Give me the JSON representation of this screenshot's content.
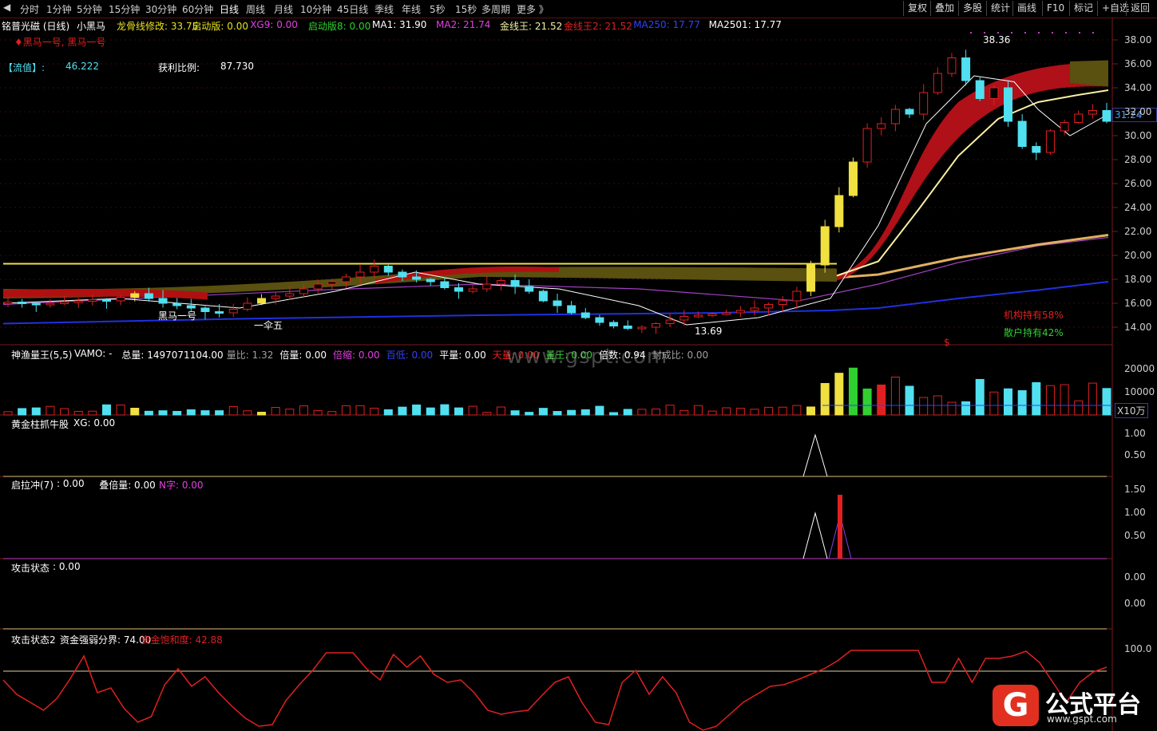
{
  "toolbar": {
    "periods": [
      "分时",
      "1分钟",
      "5分钟",
      "15分钟",
      "30分钟",
      "60分钟",
      "日线",
      "周线",
      "月线",
      "10分钟",
      "45日线",
      "季线",
      "年线",
      "5秒",
      "15秒",
      "多周期",
      "更多 》"
    ],
    "active_period": "日线",
    "right_buttons": [
      "复权",
      "叠加",
      "多股",
      "统计",
      "画线",
      "F10",
      "标记",
      "+自选",
      "返回"
    ]
  },
  "main_panel": {
    "stock_title": "铭普光磁 (日线)",
    "indicator_name": "小黑马",
    "params": [
      {
        "label": "龙骨线修改: 33.75",
        "color": "#e8e020"
      },
      {
        "label": "启动版: 0.00",
        "color": "#e8e020"
      },
      {
        "label": "XG9: 0.00",
        "color": "#e040e0"
      },
      {
        "label": "启动版8: 0.00",
        "color": "#30d030"
      },
      {
        "label": "MA1: 31.90",
        "color": "#ffffff"
      },
      {
        "label": "MA2: 21.74",
        "color": "#e040e0"
      },
      {
        "label": "金线王: 21.52",
        "color": "#f0f0a0"
      },
      {
        "label": "金线王2: 21.52",
        "color": "#e02020"
      },
      {
        "label": "MA250: 17.77",
        "color": "#3040ff"
      },
      {
        "label": "MA2501: 17.77",
        "color": "#ffffff"
      }
    ],
    "signal_text": "♦黑马一号, 黑马一号",
    "float_label": "【流值】:",
    "float_value": "46.222",
    "profit_label": "获利比例:",
    "profit_value": "87.730",
    "price_ticks": [
      "38.00",
      "36.00",
      "34.00",
      "32.00",
      "30.00",
      "28.00",
      "26.00",
      "24.00",
      "22.00",
      "20.00",
      "18.00",
      "16.00",
      "14.00"
    ],
    "current_price": "31.24",
    "high_marker": "38.36",
    "low_marker": "13.69",
    "annotation_heima": "黑马一号",
    "annotation_yisan": "一伞五",
    "inst_hold": "机构持有58%",
    "retail_hold": "散户持有42%",
    "dollar_mark": "$"
  },
  "volume_panel": {
    "title": "神渔量王(5,5)",
    "fields": [
      {
        "label": "VAMO: -",
        "color": "#ffffff"
      },
      {
        "label": "总量: 1497071104.00",
        "color": "#ffffff"
      },
      {
        "label": "量比: 1.32",
        "color": "#a0a0a0"
      },
      {
        "label": "倍量: 0.00",
        "color": "#ffffff"
      },
      {
        "label": "倍缩: 0.00",
        "color": "#e040e0"
      },
      {
        "label": "百低: 0.00",
        "color": "#3040ff"
      },
      {
        "label": "平量: 0.00",
        "color": "#ffffff"
      },
      {
        "label": "天量: 0.00",
        "color": "#e02020"
      },
      {
        "label": "量王: 0.00",
        "color": "#30d030"
      },
      {
        "label": "倍数: 0.94",
        "color": "#ffffff"
      },
      {
        "label": "封成比: 0.00",
        "color": "#a0a0a0"
      }
    ],
    "ticks": [
      "20000",
      "10000"
    ],
    "unit": "X10万"
  },
  "panel_xg": {
    "title": "黄金柱抓牛股",
    "field": "XG: 0.00",
    "ticks": [
      "1.00",
      "0.50"
    ]
  },
  "panel_qlc": {
    "title": "启拉冲(7)",
    "fields": [
      {
        "label": ": 0.00",
        "color": "#ffffff"
      },
      {
        "label": "叠倍量: 0.00",
        "color": "#ffffff"
      },
      {
        "label": "N字: 0.00",
        "color": "#e040e0"
      }
    ],
    "ticks": [
      "1.50",
      "1.00",
      "0.50"
    ]
  },
  "panel_attack": {
    "title": "攻击状态",
    "field": ": 0.00",
    "ticks": [
      "0.00",
      "0.00"
    ]
  },
  "panel_attack2": {
    "title": "攻击状态2",
    "fields": [
      {
        "label": "资金强弱分界: 74.00",
        "color": "#ffffff"
      },
      {
        "label": "资金饱和度: 42.88",
        "color": "#e02020"
      }
    ],
    "ticks": [
      "100.0"
    ]
  },
  "watermark": "www.gspt.com",
  "logo": {
    "icon": "G",
    "title": "公式平台",
    "url": "www.gspt.com"
  },
  "colors": {
    "up": "#e02020",
    "down": "#50e0f0",
    "bg": "#000000",
    "grid": "#6a1a1a"
  }
}
